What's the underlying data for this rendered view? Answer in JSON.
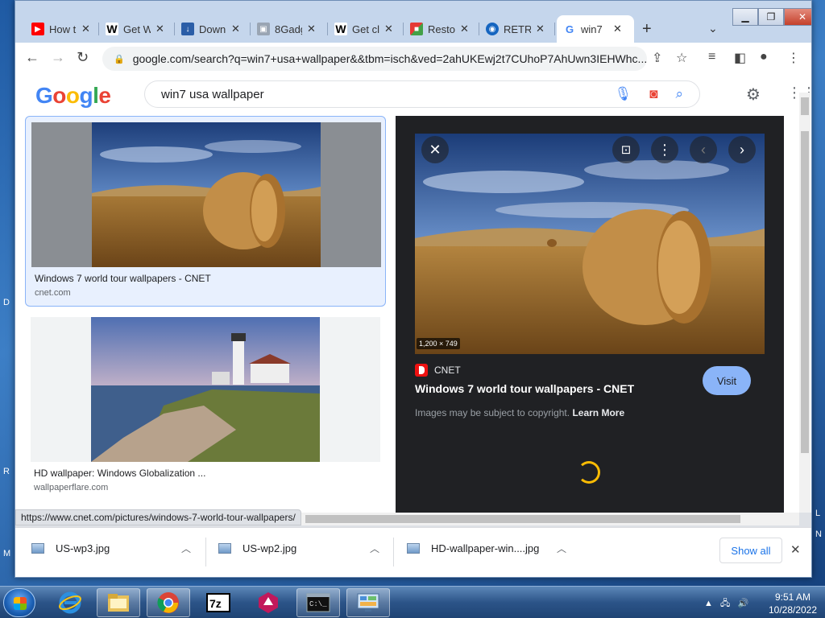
{
  "tabs": [
    {
      "label": "How t",
      "favicon": "youtube-icon",
      "color": "#ff0000"
    },
    {
      "label": "Get W",
      "favicon": "wikipedia-w-icon",
      "color": "#000000"
    },
    {
      "label": "Down",
      "favicon": "download-page-icon",
      "color": "#2b5ea7"
    },
    {
      "label": "8Gadg",
      "favicon": "gadget-icon",
      "color": "#888888"
    },
    {
      "label": "Get cl",
      "favicon": "wikipedia-w-icon",
      "color": "#000000"
    },
    {
      "label": "Resto",
      "favicon": "restore-icon",
      "color": "#e53935"
    },
    {
      "label": "RETR",
      "favicon": "retro-icon",
      "color": "#1565c0"
    },
    {
      "label": "win7",
      "favicon": "google-g-icon",
      "color": "#4285f4"
    }
  ],
  "address_bar": {
    "url": "google.com/search?q=win7+usa+wallpaper&&tbm=isch&ved=2ahUKEwj2t7CUhoP7AhUwn3IEHWhc..."
  },
  "search": {
    "query": "win7 usa wallpaper"
  },
  "logo": {
    "letters": [
      "G",
      "o",
      "o",
      "g",
      "l",
      "e"
    ],
    "colors": [
      "#4285f4",
      "#ea4335",
      "#fbbc05",
      "#4285f4",
      "#34a853",
      "#ea4335"
    ]
  },
  "results": [
    {
      "title": "Windows 7 world tour wallpapers - CNET",
      "source": "cnet.com"
    },
    {
      "title": "HD wallpaper: Windows Globalization ...",
      "source": "wallpaperflare.com"
    }
  ],
  "viewer": {
    "dimensions": "1,200 × 749",
    "source_name": "CNET",
    "title": "Windows 7 world tour wallpapers - CNET",
    "copyright_text": "Images may be subject to copyright.",
    "learn_more": "Learn More",
    "visit_label": "Visit"
  },
  "status_url": "https://www.cnet.com/pictures/windows-7-world-tour-wallpapers/",
  "downloads": [
    {
      "filename": "US-wp3.jpg"
    },
    {
      "filename": "US-wp2.jpg"
    },
    {
      "filename": "HD-wallpaper-win....jpg"
    }
  ],
  "shelf": {
    "show_all": "Show all"
  },
  "clock": {
    "time": "9:51 AM",
    "date": "10/28/2022"
  }
}
